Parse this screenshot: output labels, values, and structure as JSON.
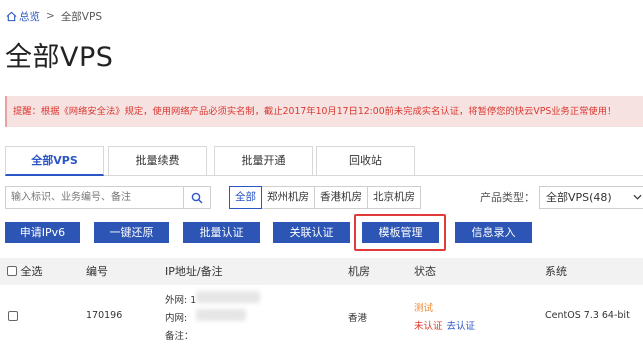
{
  "breadcrumb": {
    "home": "总览",
    "separator": ">",
    "current": "全部VPS"
  },
  "page_title": "全部VPS",
  "alert_text": "提醒：根据《网络安全法》规定，使用网络产品必须实名制，截止2017年10月17日12:00前未完成实名认证，将暂停您的快云VPS业务正常使用！",
  "tabs": [
    {
      "label": "全部VPS",
      "active": true
    },
    {
      "label": "批量续费",
      "active": false
    },
    {
      "label": "批量开通",
      "active": false
    },
    {
      "label": "回收站",
      "active": false
    }
  ],
  "search": {
    "placeholder": "输入标识、业务编号、备注"
  },
  "filters": [
    {
      "label": "全部",
      "active": true
    },
    {
      "label": "郑州机房",
      "active": false
    },
    {
      "label": "香港机房",
      "active": false
    },
    {
      "label": "北京机房",
      "active": false
    }
  ],
  "product_type": {
    "label": "产品类型：",
    "selected": "全部VPS(48)"
  },
  "actions": [
    {
      "label": "申请IPv6"
    },
    {
      "label": "一键还原"
    },
    {
      "label": "批量认证"
    },
    {
      "label": "关联认证"
    },
    {
      "label": "模板管理",
      "highlighted": true
    },
    {
      "label": "信息录入"
    }
  ],
  "table": {
    "headers": {
      "select_all": "全选",
      "number": "编号",
      "ip_note": "IP地址/备注",
      "room": "机房",
      "status": "状态",
      "system": "系统"
    },
    "rows": [
      {
        "number": "170196",
        "ip_outer_label": "外网: 1",
        "ip_inner_label": "内网:",
        "note_label": "备注：",
        "room": "香港",
        "status_line1": "测试",
        "status_unverified": "未认证",
        "status_verify_link": "去认证",
        "system": "CentOS 7.3 64-bit"
      }
    ]
  },
  "colors": {
    "accent": "#2c55b5",
    "alert_bg": "#f7e2e2",
    "alert_text": "#d9372f",
    "highlight": "#e03a3a",
    "status_test": "#f0872b"
  }
}
